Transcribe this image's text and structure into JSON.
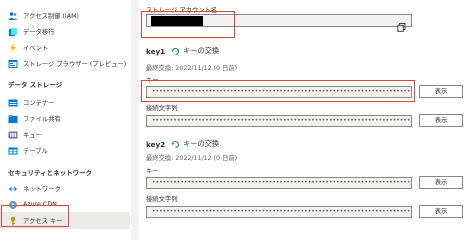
{
  "colors": {
    "accent": "#0078d4",
    "highlight": "#e0453b",
    "key_icon": "#c19c00"
  },
  "sidebar": {
    "items_top": [
      {
        "label": "アクセス制御 (IAM)",
        "icon": "people-icon"
      },
      {
        "label": "データ移行",
        "icon": "data-migration-icon"
      },
      {
        "label": "イベント",
        "icon": "lightning-icon"
      },
      {
        "label": "ストレージ ブラウザー (プレビュー)",
        "icon": "storage-browser-icon"
      }
    ],
    "section_data_storage": "データ ストレージ",
    "items_storage": [
      {
        "label": "コンテナー",
        "icon": "container-icon"
      },
      {
        "label": "ファイル共有",
        "icon": "file-share-icon"
      },
      {
        "label": "キュー",
        "icon": "queue-icon"
      },
      {
        "label": "テーブル",
        "icon": "table-icon"
      }
    ],
    "section_security": "セキュリティとネットワーク",
    "items_security": [
      {
        "label": "ネットワーク",
        "icon": "network-icon"
      },
      {
        "label": "Azure CDN",
        "icon": "cdn-icon"
      },
      {
        "label": "アクセス キー",
        "icon": "key-icon"
      }
    ]
  },
  "main": {
    "account_label": "ストレージ アカウント名",
    "key1": {
      "title": "key1",
      "rotate_label": "キーの交換",
      "last_rotated": "最終交換: 2022/11/12 (0 日前)",
      "key_label": "キー",
      "key_value": "••••••••••••••••••••••••••••••••••••••••••••••••••••••••••••••••••••••••••••••••••••••••••••",
      "conn_label": "接続文字列",
      "conn_value": "••••••••••••••••••••••••••••••••••••••••••••••••••••••••••••••••••••••••••••••••••••••••••••",
      "show_label": "表示"
    },
    "key2": {
      "title": "key2",
      "rotate_label": "キーの交換",
      "last_rotated": "最終交換: 2022/11/12 (0 日前)",
      "key_label": "キー",
      "key_value": "••••••••••••••••••••••••••••••••••••••••••••••••••••••••••••••••••••••••••••••••••••••••••••",
      "conn_label": "接続文字列",
      "conn_value": "••••••••••••••••••••••••••••••••••••••••••••••••••••••••••••••••••••••••••••••••••••••••••••",
      "show_label": "表示"
    }
  }
}
